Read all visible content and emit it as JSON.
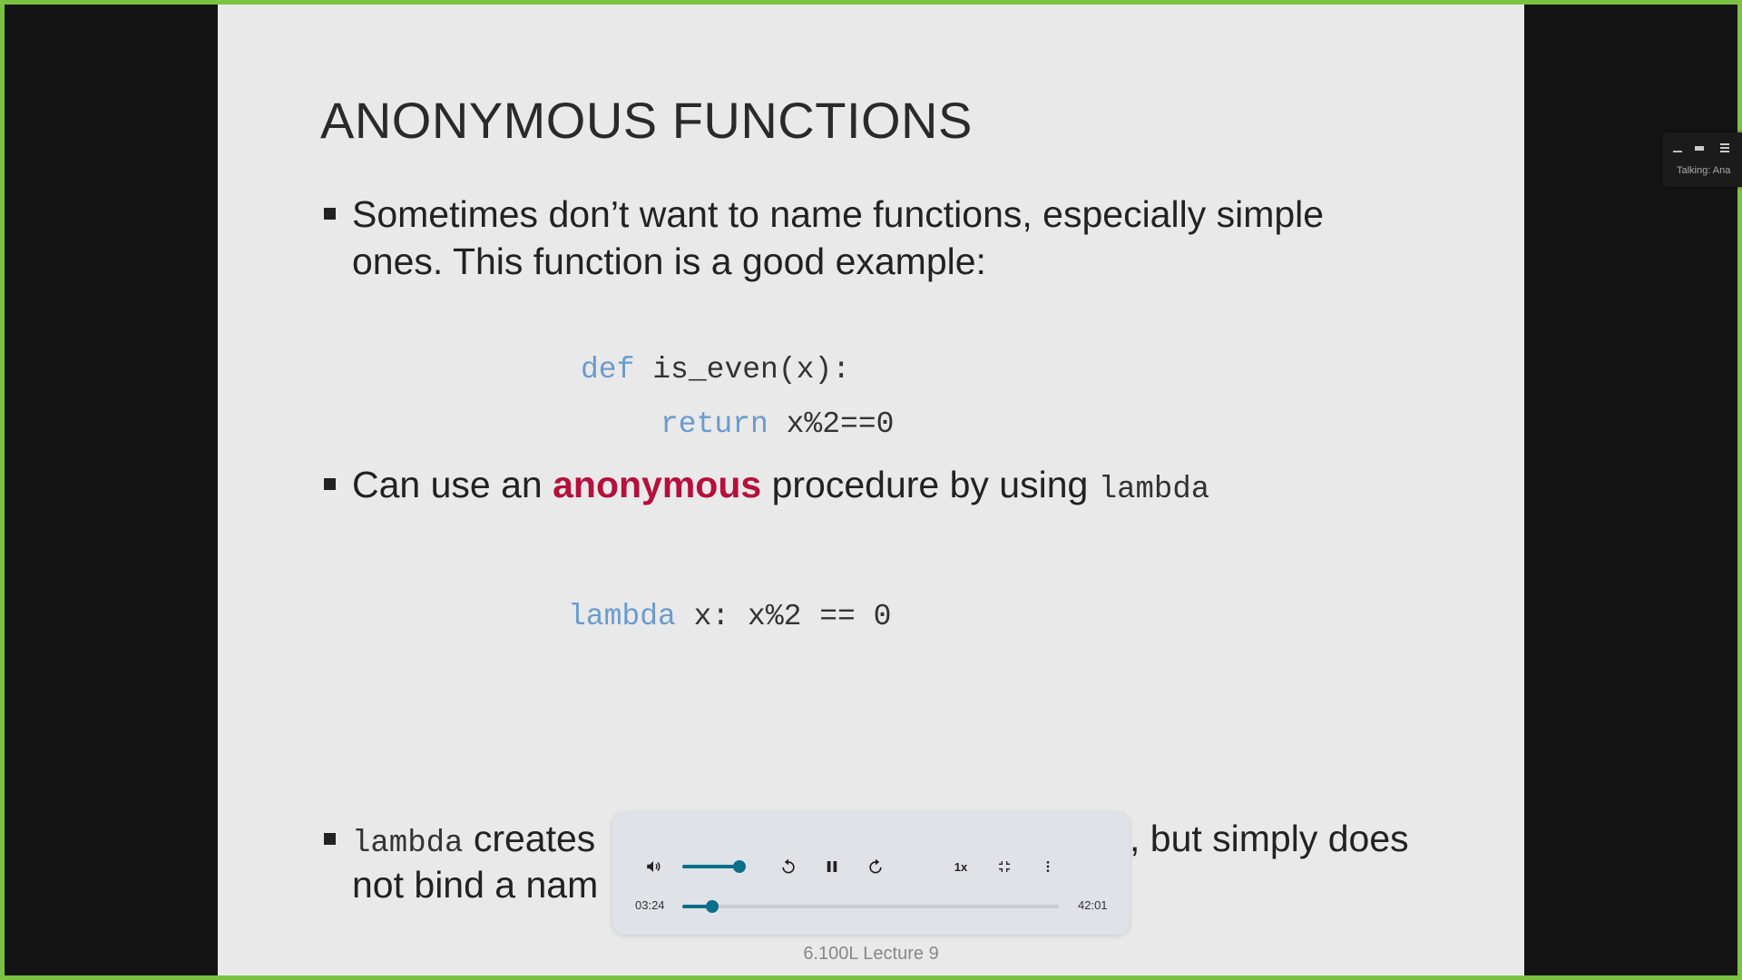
{
  "slide": {
    "title": "ANONYMOUS FUNCTIONS",
    "bullet1": "Sometimes don’t want to name functions, especially simple ones. This function is a good example:",
    "code1_kw": "def",
    "code1_rest": " is_even(x):",
    "code2_kw": "return",
    "code2_rest": " x%2==0",
    "bullet2_pre": "Can use an ",
    "bullet2_hl": "anonymous",
    "bullet2_mid": " procedure by using ",
    "bullet2_code": "lambda",
    "lambda_kw": "lambda",
    "lambda_rest": " x: x%2 == 0",
    "bullet3_code": "lambda",
    "bullet3_line1_visible": " creates",
    "bullet3_line1_right": ", but simply does",
    "bullet3_line2_visible": "not bind a nam",
    "footer": "6.100L Lecture 9"
  },
  "player": {
    "current_time": "03:24",
    "duration": "42:01",
    "speed": "1x",
    "volume_fraction": 0.9,
    "progress_fraction": 0.08
  },
  "side_widget": {
    "talking_label": "Talking: Ana"
  },
  "colors": {
    "frame_border": "#7cc242",
    "keyword": "#6a9ccf",
    "highlight": "#b5103b",
    "player_accent": "#0d6e8c"
  }
}
